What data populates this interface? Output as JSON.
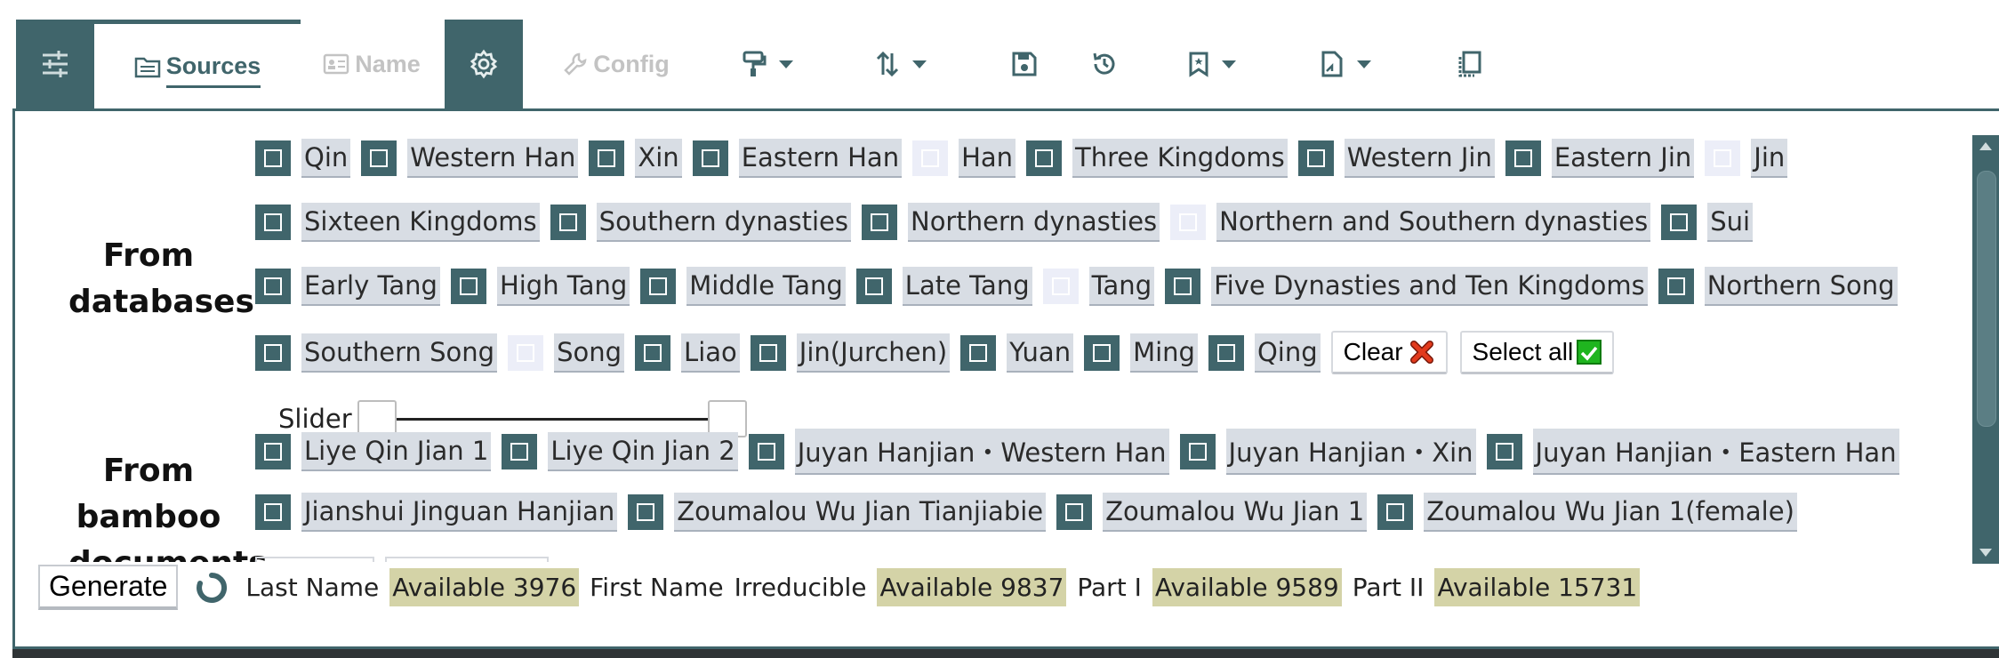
{
  "toolbar": {
    "sources_label": "Sources",
    "name_label": "Name",
    "config_label": "Config"
  },
  "databases": {
    "label_line1": "From",
    "label_line2": "databases",
    "rows": [
      [
        {
          "label": "Qin",
          "checked": true
        },
        {
          "label": "Western Han",
          "checked": true
        },
        {
          "label": "Xin",
          "checked": true
        },
        {
          "label": "Eastern Han",
          "checked": true
        },
        {
          "label": "Han",
          "checked": false
        },
        {
          "label": "Three Kingdoms",
          "checked": true
        },
        {
          "label": "Western Jin",
          "checked": true
        },
        {
          "label": "Eastern Jin",
          "checked": true
        },
        {
          "label": "Jin",
          "checked": false
        }
      ],
      [
        {
          "label": "Sixteen Kingdoms",
          "checked": true
        },
        {
          "label": "Southern dynasties",
          "checked": true
        },
        {
          "label": "Northern dynasties",
          "checked": true
        },
        {
          "label": "Northern and Southern dynasties",
          "checked": false
        },
        {
          "label": "Sui",
          "checked": true
        }
      ],
      [
        {
          "label": "Early Tang",
          "checked": true
        },
        {
          "label": "High Tang",
          "checked": true
        },
        {
          "label": "Middle Tang",
          "checked": true
        },
        {
          "label": "Late Tang",
          "checked": true
        },
        {
          "label": "Tang",
          "checked": false
        },
        {
          "label": "Five Dynasties and Ten Kingdoms",
          "checked": true
        },
        {
          "label": "Northern Song",
          "checked": true
        }
      ],
      [
        {
          "label": "Southern Song",
          "checked": true
        },
        {
          "label": "Song",
          "checked": false
        },
        {
          "label": "Liao",
          "checked": true
        },
        {
          "label": "Jin(Jurchen)",
          "checked": true
        },
        {
          "label": "Yuan",
          "checked": true
        },
        {
          "label": "Ming",
          "checked": true
        },
        {
          "label": "Qing",
          "checked": true
        }
      ]
    ],
    "clear_label": "Clear",
    "select_all_label": "Select all"
  },
  "slider": {
    "label": "Slider"
  },
  "bamboo": {
    "label_line1": "From",
    "label_line2": "bamboo",
    "label_line3": "documents",
    "rows": [
      [
        {
          "label": "Liye Qin Jian 1",
          "checked": true
        },
        {
          "label": "Liye Qin Jian 2",
          "checked": true
        },
        {
          "label": "Juyan Hanjian・Western Han",
          "checked": true
        },
        {
          "label": "Juyan Hanjian・Xin",
          "checked": true
        },
        {
          "label": "Juyan Hanjian・Eastern Han",
          "checked": true
        }
      ],
      [
        {
          "label": "Jianshui Jinguan Hanjian",
          "checked": true
        },
        {
          "label": "Zoumalou Wu Jian Tianjiabie",
          "checked": true
        },
        {
          "label": "Zoumalou Wu Jian 1",
          "checked": true
        },
        {
          "label": "Zoumalou Wu Jian 1(female)",
          "checked": true
        }
      ]
    ]
  },
  "status": {
    "generate_label": "Generate",
    "last_name_label": "Last Name",
    "last_name_available": "Available 3976",
    "first_name_label": "First Name",
    "irreducible_label": "Irreducible",
    "irreducible_available": "Available 9837",
    "part1_label": "Part I",
    "part1_available": "Available 9589",
    "part2_label": "Part II",
    "part2_available": "Available 15731"
  },
  "colors": {
    "accent": "#40656b",
    "tag_bg": "#d8dde4",
    "available_bg": "#d4d3a7"
  },
  "icons": [
    "sliders-icon",
    "folder-icon",
    "id-card-icon",
    "gear-icon",
    "wrench-icon",
    "paint-roller-icon",
    "sort-arrows-icon",
    "save-icon",
    "history-icon",
    "bookmark-icon",
    "file-export-icon",
    "copy-icon",
    "close-icon",
    "checkmark-icon",
    "spinner-icon"
  ]
}
